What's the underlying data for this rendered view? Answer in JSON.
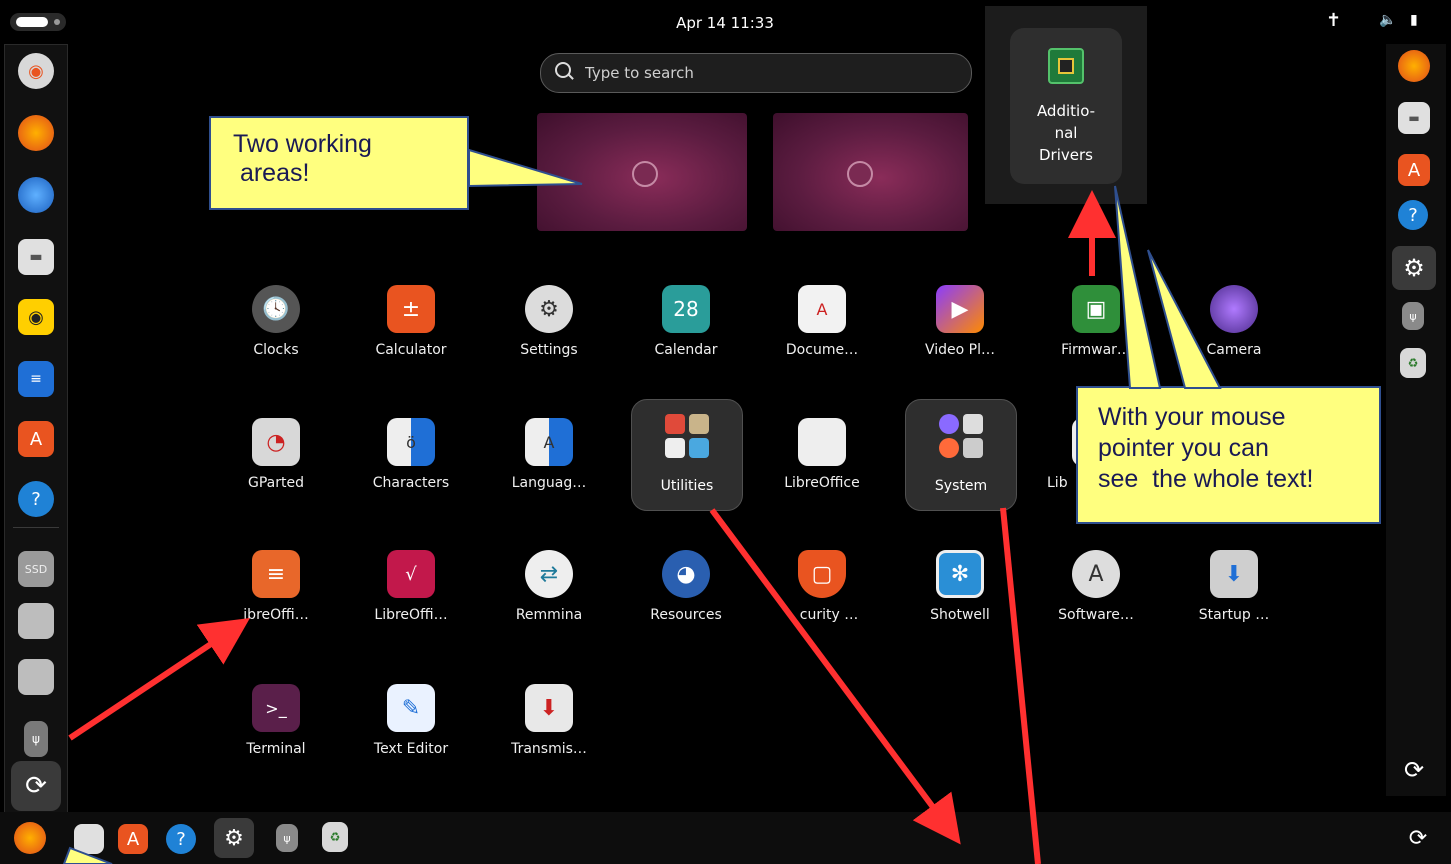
{
  "topbar": {
    "clock": "Apr 14  11:33"
  },
  "search": {
    "placeholder": "Type to search"
  },
  "callouts": {
    "a_line1": "Two working",
    "a_line2": " areas!",
    "b_line1": "With your mouse",
    "b_line2": "pointer you can",
    "b_line3": "see  the whole text!"
  },
  "drag_popup": {
    "line1": "Additio-",
    "line2": "nal",
    "line3": "Drivers"
  },
  "apps": [
    {
      "label": "Clocks",
      "icon": "clock-icon"
    },
    {
      "label": "Calculator",
      "icon": "calculator-icon"
    },
    {
      "label": "Settings",
      "icon": "gear-icon"
    },
    {
      "label": "Calendar",
      "icon": "calendar-icon",
      "badge": "28"
    },
    {
      "label": "Docume…",
      "icon": "document-icon"
    },
    {
      "label": "Video Pl…",
      "icon": "video-icon"
    },
    {
      "label": "Firmwar…",
      "icon": "chip-icon"
    },
    {
      "label": "Camera",
      "icon": "camera-icon"
    },
    {
      "label": "GParted",
      "icon": "disk-icon"
    },
    {
      "label": "Characters",
      "icon": "characters-icon"
    },
    {
      "label": "Languag…",
      "icon": "language-icon"
    },
    {
      "label": "Utilities",
      "icon": "folder-icon"
    },
    {
      "label": "LibreOffice",
      "icon": "libreoffice-icon"
    },
    {
      "label": "System",
      "icon": "folder-icon"
    },
    {
      "label": "Lib",
      "icon": "libreoffice-icon"
    },
    {
      "label": "ibreOffi…",
      "icon": "impress-icon"
    },
    {
      "label": "LibreOffi…",
      "icon": "calc-icon"
    },
    {
      "label": "Remmina",
      "icon": "remote-icon"
    },
    {
      "label": "Resources",
      "icon": "gauge-icon"
    },
    {
      "label": "curity …",
      "icon": "shield-icon"
    },
    {
      "label": "Shotwell",
      "icon": "photo-icon"
    },
    {
      "label": "Software…",
      "icon": "updater-icon"
    },
    {
      "label": "Startup …",
      "icon": "usb-icon"
    },
    {
      "label": "Terminal",
      "icon": "terminal-icon"
    },
    {
      "label": "Text Editor",
      "icon": "text-editor-icon"
    },
    {
      "label": "Transmis…",
      "icon": "transmission-icon"
    }
  ],
  "dock_left": [
    "installer-icon",
    "firefox-icon",
    "thunderbird-icon",
    "files-icon",
    "rhythmbox-icon",
    "writer-icon",
    "app-center-icon",
    "help-icon",
    "ssd-icon",
    "drive-icon",
    "drive-icon",
    "usb-icon",
    "show-apps-icon"
  ],
  "dock_left_ssd": "SSD",
  "dock_right": [
    "firefox-icon",
    "files-icon",
    "app-center-icon",
    "help-icon",
    "settings-icon",
    "usb-icon",
    "trash-icon",
    "show-apps-icon"
  ],
  "dock_bottom": [
    "firefox-icon",
    "files-icon",
    "app-center-icon",
    "help-icon",
    "settings-icon",
    "usb-icon",
    "trash-icon",
    "show-apps-icon"
  ],
  "colors": {
    "accent": "#e95420",
    "workspace": "#6b1f4a",
    "callout_fill": "#ffff7f",
    "callout_border": "#2f4f8f",
    "arrow": "#ff3030"
  }
}
